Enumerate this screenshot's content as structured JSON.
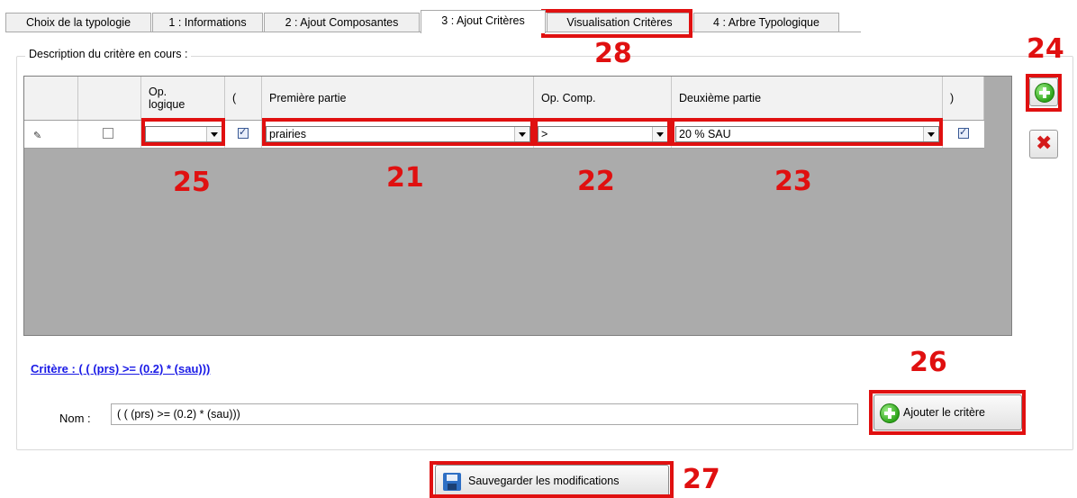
{
  "tabs": [
    {
      "label": "Choix de la typologie"
    },
    {
      "label": "1 : Informations"
    },
    {
      "label": "2 : Ajout Composantes"
    },
    {
      "label": "3 : Ajout Critères"
    },
    {
      "label": "Visualisation Critères"
    },
    {
      "label": "4 : Arbre Typologique"
    }
  ],
  "active_tab": "3 : Ajout Critères",
  "group_title": "Description du critère en cours :",
  "grid": {
    "headers": [
      "",
      "",
      "Op.\nlogique",
      "(",
      "Première partie",
      "Op. Comp.",
      "Deuxième partie",
      ")"
    ],
    "row": {
      "selected": false,
      "op_logique": "",
      "open_paren": true,
      "premiere_partie": "prairies",
      "op_comp": ">",
      "deuxieme_partie": "20 % SAU",
      "close_paren": true
    }
  },
  "critere_text": "Critère : ( (  (prs) >=    (0.2) * (sau)))",
  "nom_label": "Nom :",
  "nom_value": "( (  (prs) >=    (0.2) * (sau)))",
  "add_criterion_label": "Ajouter le critère",
  "save_label": "Sauvegarder les modifications",
  "annotations": {
    "a21": "21",
    "a22": "22",
    "a23": "23",
    "a24": "24",
    "a25": "25",
    "a26": "26",
    "a27": "27",
    "a28": "28"
  },
  "colors": {
    "annotation_red": "#e01010",
    "link_blue": "#1a1ae6",
    "grid_gray": "#ababab"
  }
}
